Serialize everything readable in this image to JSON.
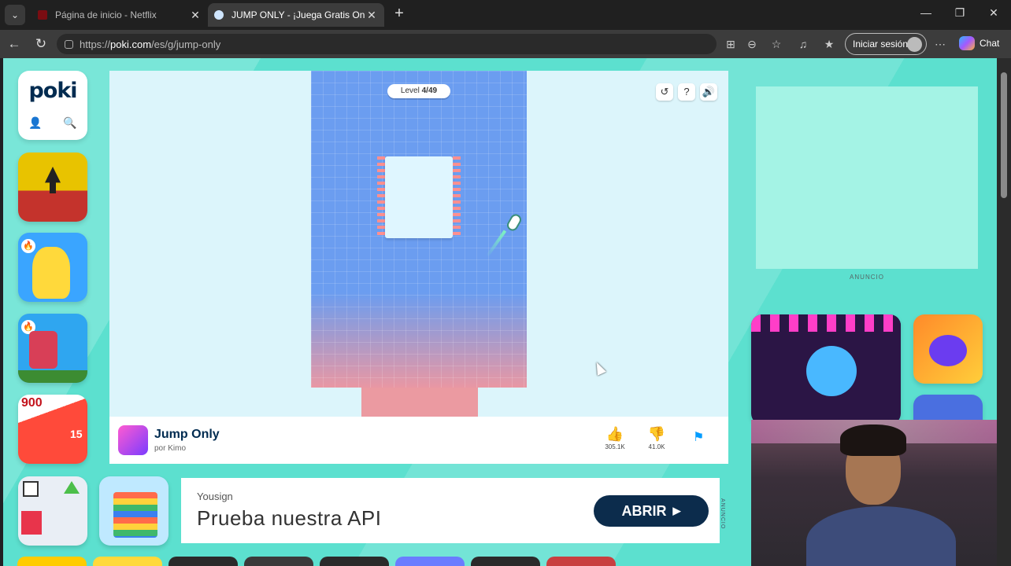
{
  "tabs": [
    {
      "title": "Página de inicio - Netflix",
      "active": false
    },
    {
      "title": "JUMP ONLY - ¡Juega Gratis Online!",
      "active": true
    }
  ],
  "address_bar": {
    "url_prefix": "https://",
    "url_host": "poki.com",
    "url_path": "/es/g/jump-only"
  },
  "toolbar": {
    "signin_label": "Iniciar sesión",
    "chat_label": "Chat"
  },
  "site": {
    "logo": "poki"
  },
  "game": {
    "level_label": "Level",
    "level_value": "4/49",
    "title": "Jump Only",
    "author": "por Kimo",
    "likes": "305.1K",
    "dislikes": "41.0K"
  },
  "ad_banner": {
    "brand": "Yousign",
    "copy": "Prueba nuestra API",
    "button": "ABRIR",
    "side_label": "ANUNCIO"
  },
  "right_column": {
    "ad_label": "ANUNCIO"
  },
  "sidebar_tiles": [
    {
      "color": "#e8c300"
    },
    {
      "color": "#3aa5ff"
    },
    {
      "color": "#2fa6f0"
    },
    {
      "color": "#ff4a3a",
      "badge": "900",
      "badge2": "15"
    },
    {
      "color": "#3b7acb"
    }
  ],
  "colors": {
    "page_bg": "#5ce0cf",
    "poki_blue": "#009cff",
    "brand_navy": "#002b50"
  }
}
